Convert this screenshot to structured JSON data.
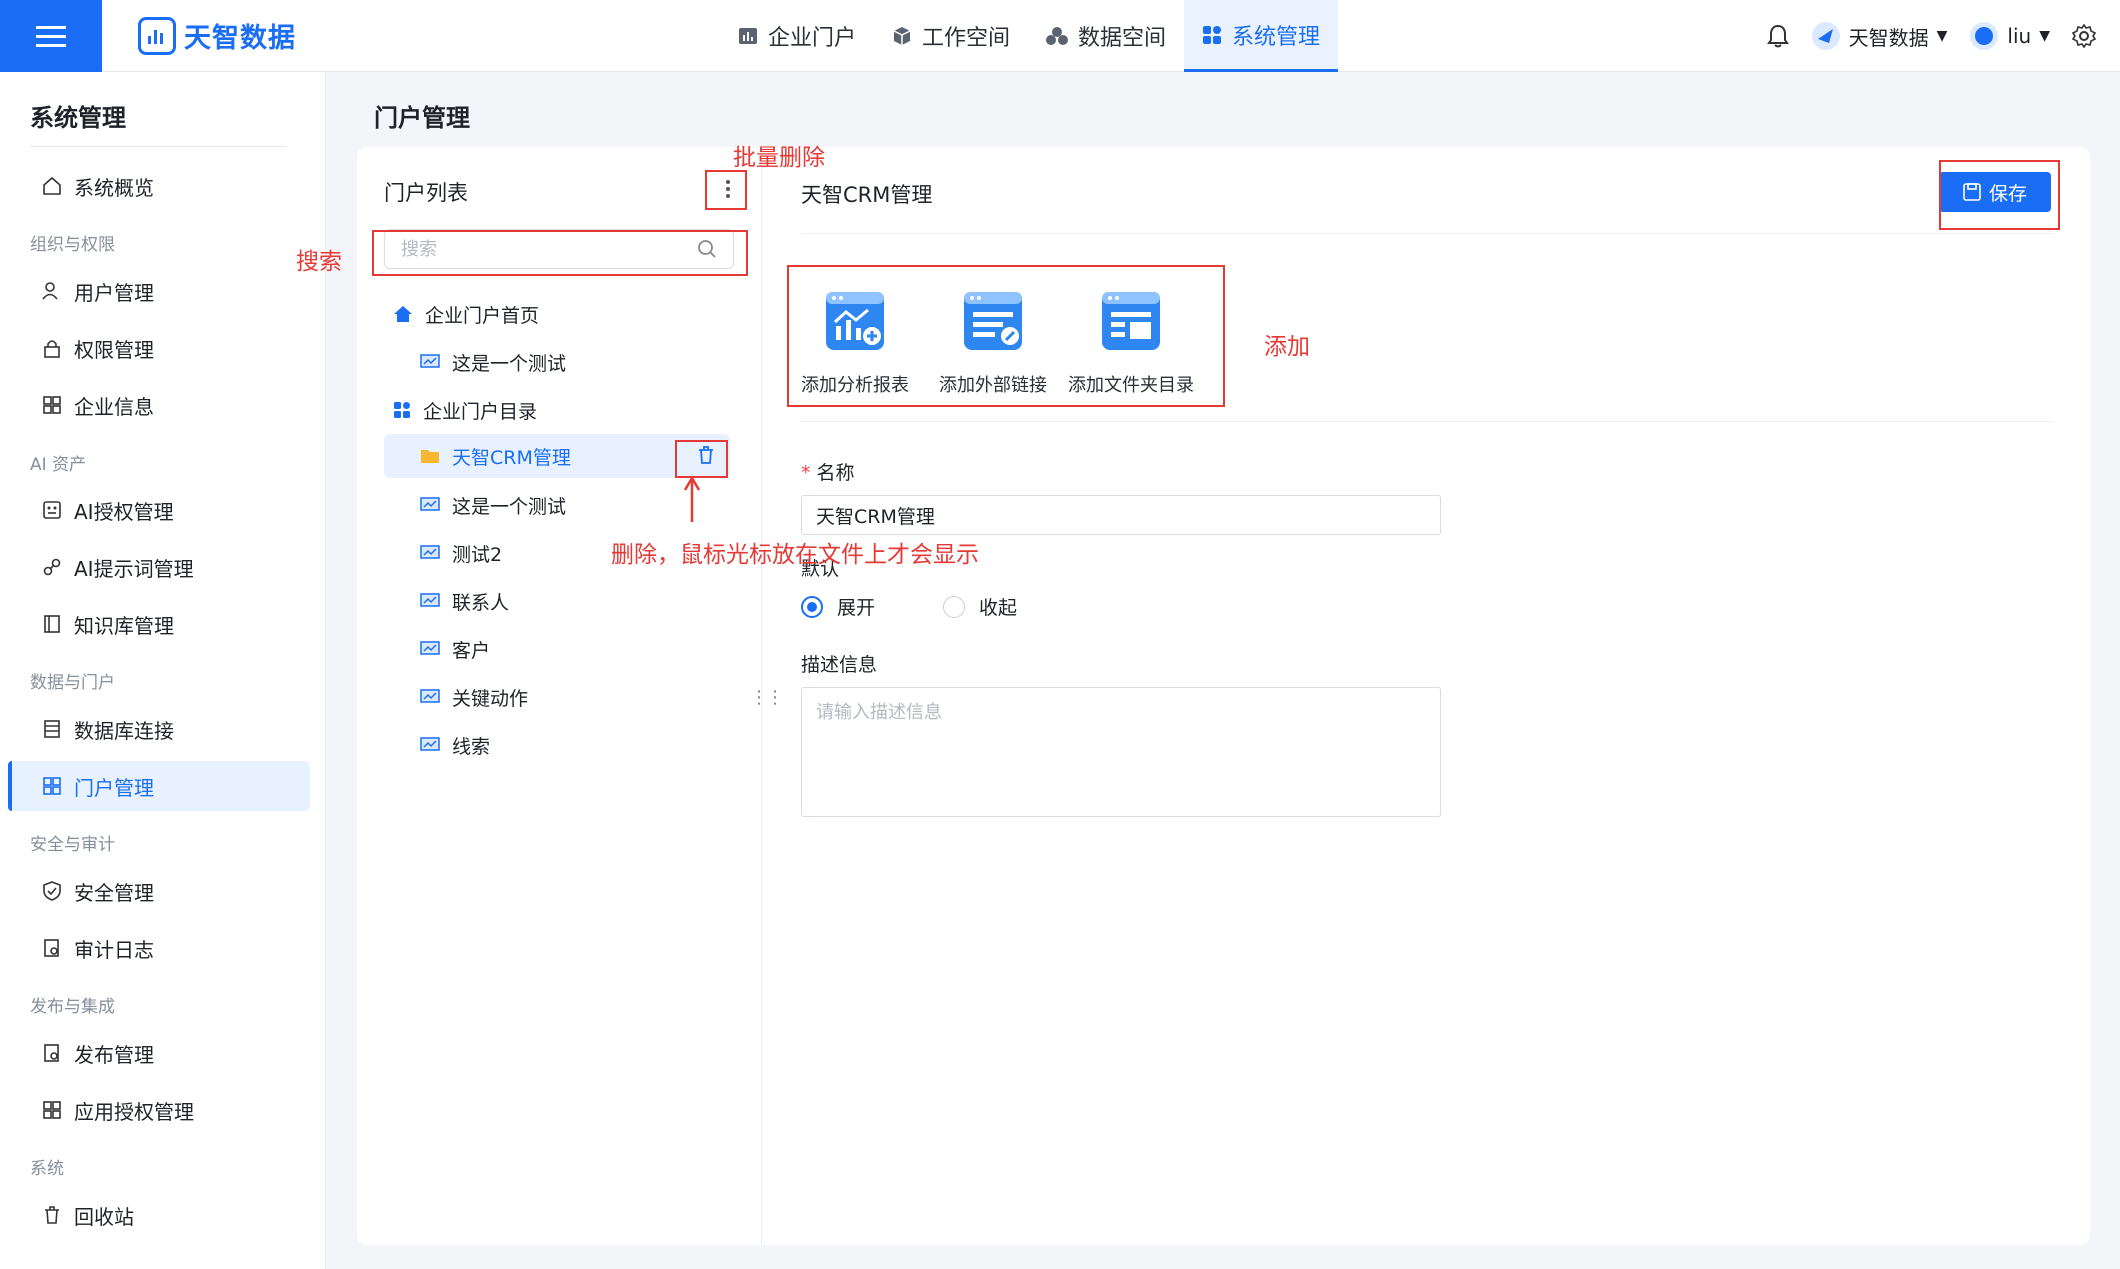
{
  "topbar": {
    "brand": "天智数据",
    "nav": [
      {
        "label": "企业门户",
        "icon": "bar-chart-icon"
      },
      {
        "label": "工作空间",
        "icon": "cube-icon"
      },
      {
        "label": "数据空间",
        "icon": "cubes-icon"
      },
      {
        "label": "系统管理",
        "icon": "grid-icon",
        "active": true
      }
    ],
    "org_label": "天智数据",
    "user_label": "liu"
  },
  "sidebar": {
    "title": "系统管理",
    "overview": "系统概览",
    "groups": {
      "org": "组织与权限",
      "ai": "AI 资产",
      "data": "数据与门户",
      "security": "安全与审计",
      "publish": "发布与集成",
      "system": "系统"
    },
    "items": {
      "users": "用户管理",
      "perm": "权限管理",
      "corp": "企业信息",
      "ai_auth": "AI授权管理",
      "ai_prompt": "AI提示词管理",
      "kb": "知识库管理",
      "db": "数据库连接",
      "portal": "门户管理",
      "safety": "安全管理",
      "audit": "审计日志",
      "release": "发布管理",
      "app_auth": "应用授权管理",
      "recycle": "回收站"
    }
  },
  "page": {
    "title": "门户管理"
  },
  "tree": {
    "title": "门户列表",
    "search_placeholder": "搜索",
    "nodes": [
      "企业门户首页",
      "这是一个测试",
      "企业门户目录",
      "天智CRM管理",
      "这是一个测试",
      "测试2",
      "联系人",
      "客户",
      "关键动作",
      "线索"
    ]
  },
  "detail": {
    "title": "天智CRM管理",
    "save_label": "保存",
    "add_report": "添加分析报表",
    "add_link": "添加外部链接",
    "add_folder": "添加文件夹目录",
    "name_label": "名称",
    "name_value": "天智CRM管理",
    "default_label": "默认",
    "expand_label": "展开",
    "collapse_label": "收起",
    "desc_label": "描述信息",
    "desc_placeholder": "请输入描述信息"
  },
  "annotations": {
    "batch_delete": "批量删除",
    "search": "搜索",
    "add": "添加",
    "delete_hint": "删除，鼠标光标放在文件上才会显示"
  },
  "colors": {
    "accent": "#1a6ef5",
    "annotation": "#e53935"
  }
}
